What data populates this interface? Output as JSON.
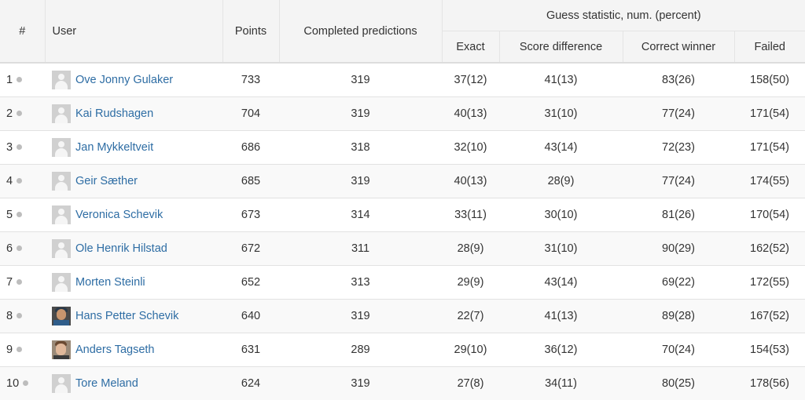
{
  "headers": {
    "rank": "#",
    "user": "User",
    "points": "Points",
    "completed": "Completed predictions",
    "group": "Guess statistic, num. (percent)",
    "exact": "Exact",
    "score_diff": "Score difference",
    "correct_winner": "Correct winner",
    "failed": "Failed"
  },
  "rows": [
    {
      "rank": "1",
      "name": "Ove Jonny Gulaker",
      "avatar": "default",
      "points": "733",
      "completed": "319",
      "exact": "37(12)",
      "score_diff": "41(13)",
      "correct_winner": "83(26)",
      "failed": "158(50)"
    },
    {
      "rank": "2",
      "name": "Kai Rudshagen",
      "avatar": "default",
      "points": "704",
      "completed": "319",
      "exact": "40(13)",
      "score_diff": "31(10)",
      "correct_winner": "77(24)",
      "failed": "171(54)"
    },
    {
      "rank": "3",
      "name": "Jan Mykkeltveit",
      "avatar": "default",
      "points": "686",
      "completed": "318",
      "exact": "32(10)",
      "score_diff": "43(14)",
      "correct_winner": "72(23)",
      "failed": "171(54)"
    },
    {
      "rank": "4",
      "name": "Geir Sæther",
      "avatar": "default",
      "points": "685",
      "completed": "319",
      "exact": "40(13)",
      "score_diff": "28(9)",
      "correct_winner": "77(24)",
      "failed": "174(55)"
    },
    {
      "rank": "5",
      "name": "Veronica Schevik",
      "avatar": "default",
      "points": "673",
      "completed": "314",
      "exact": "33(11)",
      "score_diff": "30(10)",
      "correct_winner": "81(26)",
      "failed": "170(54)"
    },
    {
      "rank": "6",
      "name": "Ole Henrik Hilstad",
      "avatar": "default",
      "points": "672",
      "completed": "311",
      "exact": "28(9)",
      "score_diff": "31(10)",
      "correct_winner": "90(29)",
      "failed": "162(52)"
    },
    {
      "rank": "7",
      "name": "Morten Steinli",
      "avatar": "default",
      "points": "652",
      "completed": "313",
      "exact": "29(9)",
      "score_diff": "43(14)",
      "correct_winner": "69(22)",
      "failed": "172(55)"
    },
    {
      "rank": "8",
      "name": "Hans Petter Schevik",
      "avatar": "photo1",
      "points": "640",
      "completed": "319",
      "exact": "22(7)",
      "score_diff": "41(13)",
      "correct_winner": "89(28)",
      "failed": "167(52)"
    },
    {
      "rank": "9",
      "name": "Anders Tagseth",
      "avatar": "photo2",
      "points": "631",
      "completed": "289",
      "exact": "29(10)",
      "score_diff": "36(12)",
      "correct_winner": "70(24)",
      "failed": "154(53)"
    },
    {
      "rank": "10",
      "name": "Tore Meland",
      "avatar": "default",
      "points": "624",
      "completed": "319",
      "exact": "27(8)",
      "score_diff": "34(11)",
      "correct_winner": "80(25)",
      "failed": "178(56)"
    }
  ],
  "colors": {
    "link": "#2e6da4",
    "dot": "#bdbdbd",
    "header_bg": "#f4f4f4",
    "alt_row": "#f9f9f9"
  }
}
